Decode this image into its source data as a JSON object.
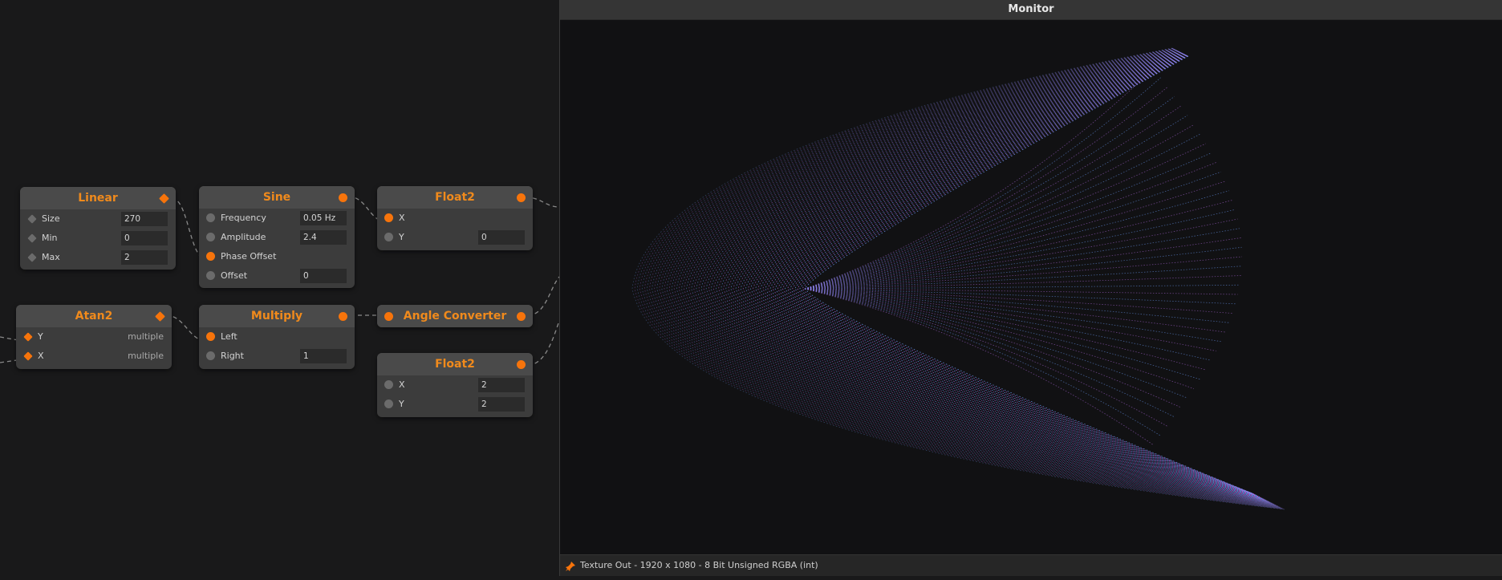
{
  "monitor": {
    "title": "Monitor",
    "status_text": "Texture Out - 1920 x 1080 - 8 Bit Unsigned RGBA (int)"
  },
  "nodes": {
    "linear": {
      "title": "Linear",
      "rows": [
        {
          "label": "Size",
          "value": "270"
        },
        {
          "label": "Min",
          "value": "0"
        },
        {
          "label": "Max",
          "value": "2"
        }
      ]
    },
    "sine": {
      "title": "Sine",
      "rows": [
        {
          "label": "Frequency",
          "value": "0.05 Hz"
        },
        {
          "label": "Amplitude",
          "value": "2.4"
        },
        {
          "label": "Phase Offset",
          "value": ""
        },
        {
          "label": "Offset",
          "value": "0"
        }
      ]
    },
    "float2_top": {
      "title": "Float2",
      "rows": [
        {
          "label": "X",
          "value": ""
        },
        {
          "label": "Y",
          "value": "0"
        }
      ]
    },
    "atan2": {
      "title": "Atan2",
      "rows": [
        {
          "label": "Y",
          "value": "multiple"
        },
        {
          "label": "X",
          "value": "multiple"
        }
      ]
    },
    "multiply": {
      "title": "Multiply",
      "rows": [
        {
          "label": "Left",
          "value": ""
        },
        {
          "label": "Right",
          "value": "1"
        }
      ]
    },
    "angle_converter": {
      "title": "Angle Converter"
    },
    "float2_bottom": {
      "title": "Float2",
      "rows": [
        {
          "label": "X",
          "value": "2"
        },
        {
          "label": "Y",
          "value": "2"
        }
      ]
    }
  },
  "colors": {
    "accent": "#f7740b",
    "node_title": "#f08a1c",
    "viz_purple": "#b46be6",
    "viz_blue": "#6fa0ff"
  },
  "icons": {
    "status_pin": "pin-icon"
  }
}
